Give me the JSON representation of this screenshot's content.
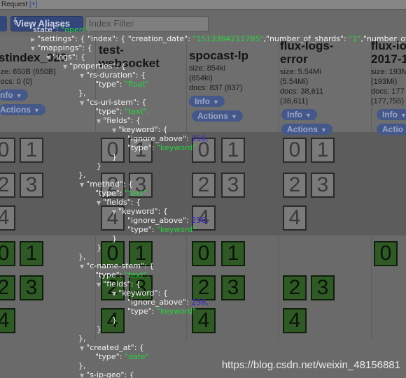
{
  "topbar": {
    "label": "Request",
    "plus": "[+]"
  },
  "toolbar": {
    "view_aliases": "View Aliases",
    "filter_placeholder": "Index Filter"
  },
  "indices": [
    {
      "name": "stindex_020",
      "line2": "",
      "size": "ize: 650B (650B)",
      "docs": "locs: 0 (0)",
      "info": "nfo",
      "actions": "Actions"
    },
    {
      "name": "test-",
      "line2": "websocket",
      "size": "",
      "docs": "",
      "info": "",
      "actions": ""
    },
    {
      "name": "spocast-lp",
      "line2": "",
      "size": "size: 854ki",
      "size2": "(854ki)",
      "docs": "docs: 837 (837)",
      "info": "Info",
      "actions": "Actions"
    },
    {
      "name": "flux-logs-",
      "line2": "error",
      "size": "size: 5.54Mi",
      "size2": "(5.54Mi)",
      "docs": "docs: 38,611",
      "docs2": "(38,611)",
      "info": "Info",
      "actions": "Actions"
    },
    {
      "name": "flux-lo",
      "line2": "2017-1",
      "size": "size: 193M",
      "size2": "(193Mi)",
      "docs": "docs: 177",
      "docs2": "(177,755)",
      "info": "Info",
      "actions": "Actio"
    }
  ],
  "shards": {
    "n0": "0",
    "n1": "1",
    "n2": "2",
    "n3": "3",
    "n4": "4"
  },
  "json_lines": [
    {
      "key": "{",
      "val": ""
    },
    {
      "key": "\"state\": ",
      "val": "\"open\","
    },
    {
      "key": "\"settings\": { \"index\": { \"creation_date\": ",
      "val": "\"1513384211785\"",
      "rest": ",\"number_of_shards\": ",
      "val2": "\"1\"",
      "rest2": ",\"number_of_rep"
    },
    {
      "key": "\"mappings\": {",
      "val": ""
    },
    {
      "key": "\"logs\": {",
      "val": ""
    },
    {
      "key": "\"properties\": {",
      "val": ""
    },
    {
      "key": "\"rs-duration\": {",
      "val": ""
    },
    {
      "key": "\"type\": ",
      "val": "\"float\""
    },
    {
      "key": "},",
      "val": ""
    },
    {
      "key": "\"cs-uri-stem\": {",
      "val": ""
    },
    {
      "key": "\"type\": ",
      "val": "\"text\","
    },
    {
      "key": "\"fields\": {",
      "val": ""
    },
    {
      "key": "\"keyword\": {",
      "val": ""
    },
    {
      "key": "\"ignore_above\": ",
      "val": "256,"
    },
    {
      "key": "\"type\": ",
      "val": "\"keyword\""
    },
    {
      "key": "}",
      "val": ""
    },
    {
      "key": "}",
      "val": ""
    },
    {
      "key": "},",
      "val": ""
    },
    {
      "key": "\"method\": {",
      "val": ""
    },
    {
      "key": "\"type\": ",
      "val": "\"text\","
    },
    {
      "key": "\"fields\": {",
      "val": ""
    },
    {
      "key": "\"keyword\": {",
      "val": ""
    },
    {
      "key": "\"ignore_above\": ",
      "val": "256,"
    },
    {
      "key": "\"type\": ",
      "val": "\"keyword\""
    },
    {
      "key": "}",
      "val": ""
    },
    {
      "key": "}",
      "val": ""
    },
    {
      "key": "},",
      "val": ""
    },
    {
      "key": "\"c-name-stem\": {",
      "val": ""
    },
    {
      "key": "\"type\": ",
      "val": "\"text\","
    },
    {
      "key": "\"fields\": {",
      "val": ""
    },
    {
      "key": "\"keyword\": {",
      "val": ""
    },
    {
      "key": "\"ignore_above\": ",
      "val": "256,"
    },
    {
      "key": "\"type\": ",
      "val": "\"keyword\""
    },
    {
      "key": "}",
      "val": ""
    },
    {
      "key": "}",
      "val": ""
    },
    {
      "key": "},",
      "val": ""
    },
    {
      "key": "\"created_at\": {",
      "val": ""
    },
    {
      "key": "\"type\": ",
      "val": "\"date\""
    },
    {
      "key": "},",
      "val": ""
    },
    {
      "key": "\"s-ip-geo\": {",
      "val": ""
    }
  ],
  "watermark": "https://blog.csdn.net/weixin_48156881",
  "colors": {
    "json_key": "#f2f2f2",
    "json_string": "#29d33d",
    "json_number": "#3524c8",
    "shard_assigned": "#2f5a26"
  }
}
